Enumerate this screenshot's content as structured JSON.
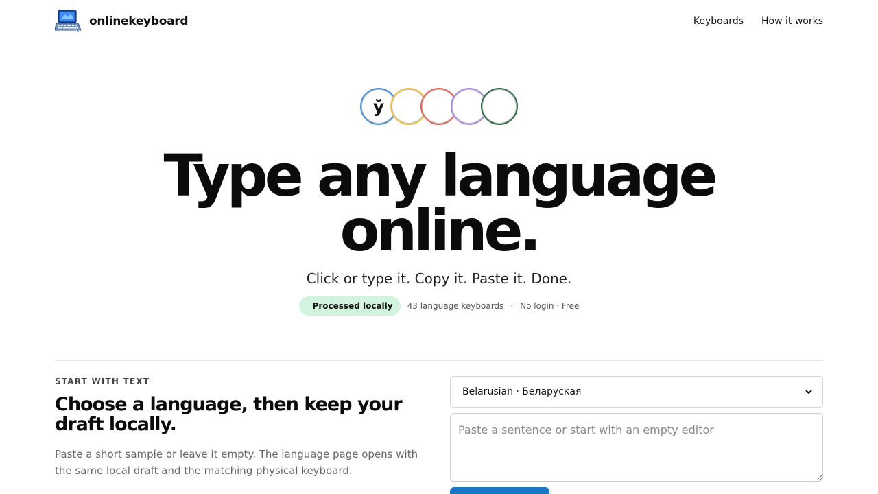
{
  "nav": {
    "brand": "onlinekeyboard",
    "links": [
      {
        "label": "Keyboards"
      },
      {
        "label": "How it works"
      }
    ]
  },
  "hero": {
    "circles": [
      {
        "glyph": "ў",
        "color": "#4a8fd1"
      },
      {
        "glyph": "",
        "color": "#f0c246"
      },
      {
        "glyph": "",
        "color": "#e0685a"
      },
      {
        "glyph": "",
        "color": "#a98ee0"
      },
      {
        "glyph": "",
        "color": "#2f6b47"
      }
    ],
    "headline_line1": "Type any language",
    "headline_line2": "online.",
    "subline": "Click or type it. Copy it. Paste it. Done.",
    "badge": "Processed locally",
    "keyboards_count": "43 language keyboards",
    "separator": "·",
    "access": "No login · Free"
  },
  "start": {
    "eyebrow": "START WITH TEXT",
    "title": "Choose a language, then keep your draft locally.",
    "description": "Paste a short sample or leave it empty. The language page opens with the same local draft and the matching physical keyboard.",
    "selected_language": "Belarusian · Беларуская",
    "editor_placeholder": "Paste a sentence or start with an empty editor",
    "editor_value": "",
    "submit_label": ""
  },
  "icons": {
    "brand": "laptop-keyboard-logo-icon",
    "select": "chevron-down-icon"
  },
  "colors": {
    "accent": "#1976c5",
    "badge_bg": "#d2f3dd"
  }
}
